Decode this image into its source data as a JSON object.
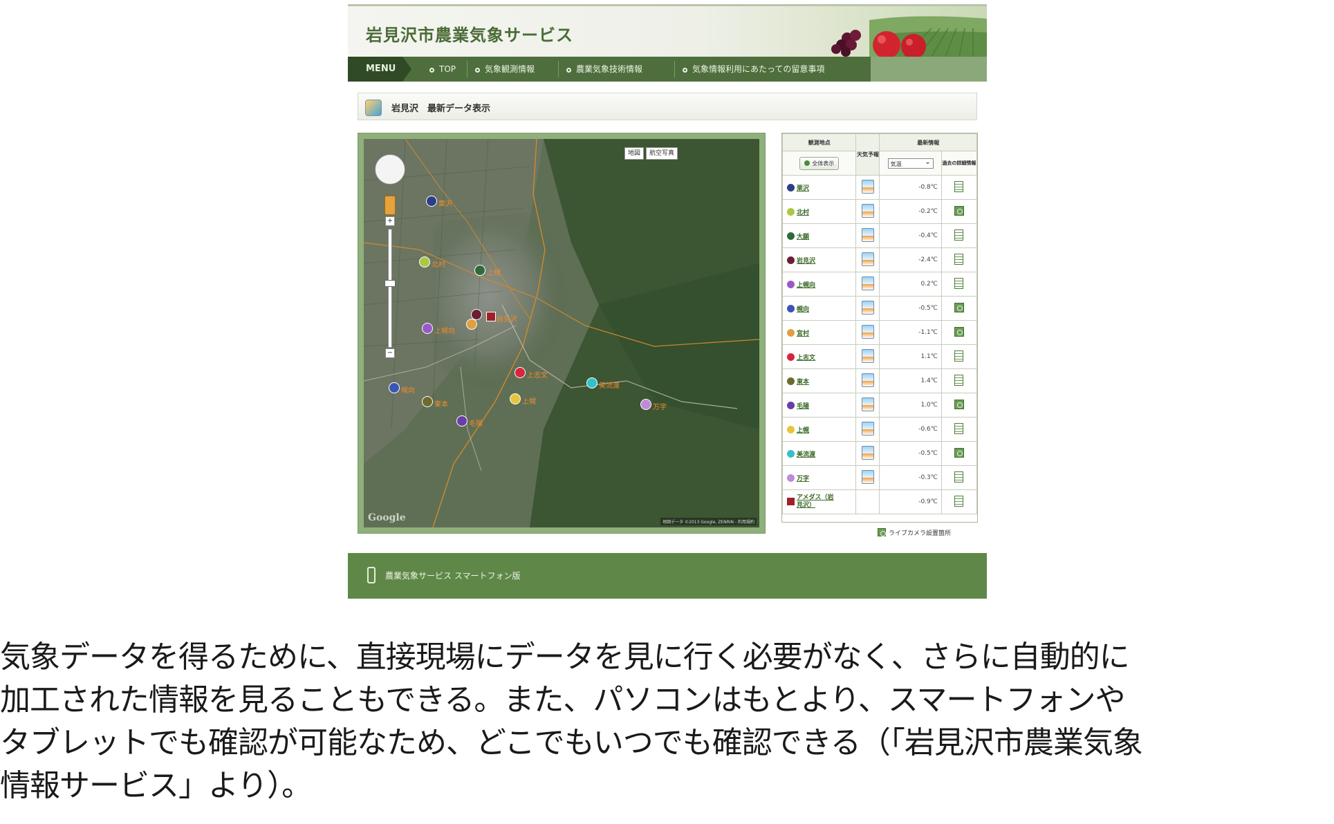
{
  "site": {
    "title": "岩見沢市農業気象サービス"
  },
  "menu": {
    "label": "MENU",
    "items": [
      {
        "label": "TOP"
      },
      {
        "label": "気象観測情報"
      },
      {
        "label": "農業気象技術情報"
      },
      {
        "label": "気象情報利用にあたっての留意事項"
      }
    ]
  },
  "page": {
    "heading": "岩見沢　最新データ表示"
  },
  "map": {
    "buttons": {
      "map": "地図",
      "satellite": "航空写真"
    },
    "google": "Google",
    "attribution": "地図データ ©2013 Google, ZENRIN - 利用規約",
    "stations": [
      {
        "label": "栗沢",
        "color": "#2c3f86"
      },
      {
        "label": "北村",
        "color": "#a9c844"
      },
      {
        "label": "上幌",
        "color": "#2f6b3a"
      },
      {
        "label": "岩見沢",
        "color": "#6a1f35"
      },
      {
        "label": "上志文",
        "color": "#d6263b"
      },
      {
        "label": "美流渡",
        "color": "#35c0c8"
      },
      {
        "label": "上幌",
        "color": "#e8c43a"
      },
      {
        "label": "毛陽",
        "color": "#b35bd0"
      },
      {
        "label": "幌向",
        "color": "#3c55b3"
      },
      {
        "label": "東本",
        "color": "#6f6a2f"
      },
      {
        "label": "上幌向",
        "color": "#9b59c8"
      },
      {
        "label": "万字",
        "color": "#c08ad8"
      }
    ]
  },
  "table": {
    "headers": {
      "location": "観測地点",
      "forecast": "天気予報",
      "data": "最新情報",
      "detail": "過去の詳細情報"
    },
    "all_button": "全体表示",
    "select_value": "気温",
    "rows": [
      {
        "name": "栗沢",
        "color": "#2c3f86",
        "value": "-0.8℃",
        "icon": "doc"
      },
      {
        "name": "北村",
        "color": "#a9c844",
        "value": "-0.2℃",
        "icon": "chart"
      },
      {
        "name": "大願",
        "color": "#2f6b3a",
        "value": "-0.4℃",
        "icon": "doc"
      },
      {
        "name": "岩見沢",
        "color": "#6a1f35",
        "value": "-2.4℃",
        "icon": "doc"
      },
      {
        "name": "上幌向",
        "color": "#9b59c8",
        "value": "0.2℃",
        "icon": "doc"
      },
      {
        "name": "幌向",
        "color": "#3c55b3",
        "value": "-0.5℃",
        "icon": "chart"
      },
      {
        "name": "宮村",
        "color": "#e0a040",
        "value": "-1.1℃",
        "icon": "chart"
      },
      {
        "name": "上志文",
        "color": "#d6263b",
        "value": "1.1℃",
        "icon": "doc"
      },
      {
        "name": "東本",
        "color": "#6f6a2f",
        "value": "1.4℃",
        "icon": "doc"
      },
      {
        "name": "毛陽",
        "color": "#6a3ea8",
        "value": "1.0℃",
        "icon": "chart"
      },
      {
        "name": "上幌",
        "color": "#e8c43a",
        "value": "-0.6℃",
        "icon": "doc"
      },
      {
        "name": "美流渡",
        "color": "#35c0c8",
        "value": "-0.5℃",
        "icon": "chart"
      },
      {
        "name": "万字",
        "color": "#c08ad8",
        "value": "-0.3℃",
        "icon": "doc"
      },
      {
        "name": "アメダス（岩見沢）",
        "color": "#a0202a",
        "value": "-0.9℃",
        "icon": "doc",
        "square": true
      }
    ],
    "legend": "ライブカメラ設置箇所"
  },
  "footer": {
    "link": "農業気象サービス スマートフォン版"
  },
  "caption": {
    "lines": [
      "気象データを得るために、直接現場にデータを見に行く必要がなく、さらに自動的に",
      "加工された情報を見ることもできる。また、パソコンはもとより、スマートフォンや",
      "タブレットでも確認が可能なため、どこでもいつでも確認できる（「岩見沢市農業気象",
      "情報サービス」より）。"
    ]
  },
  "colors": {
    "brand_green": "#4f6e3d",
    "menu_dark": "#2f4a25",
    "footer_green": "#5f8848"
  }
}
